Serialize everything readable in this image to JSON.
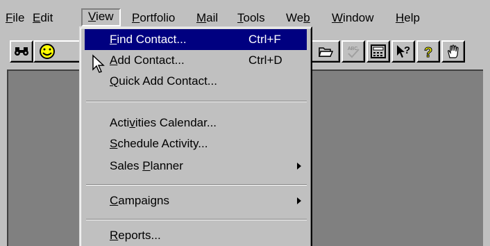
{
  "menubar": {
    "items": [
      {
        "pre": "",
        "acc": "F",
        "post": "ile"
      },
      {
        "pre": "",
        "acc": "E",
        "post": "dit"
      },
      {
        "pre": "",
        "acc": "V",
        "post": "iew"
      },
      {
        "pre": "",
        "acc": "P",
        "post": "ortfolio"
      },
      {
        "pre": "",
        "acc": "M",
        "post": "ail"
      },
      {
        "pre": "",
        "acc": "T",
        "post": "ools"
      },
      {
        "pre": "We",
        "acc": "b",
        "post": ""
      },
      {
        "pre": "",
        "acc": "W",
        "post": "indow"
      },
      {
        "pre": "",
        "acc": "H",
        "post": "elp"
      }
    ]
  },
  "toolbar": {
    "buttons": [
      {
        "icon": "binoculars-icon"
      },
      {
        "icon": "smiley-icon"
      },
      {
        "icon": "open-folder-icon"
      },
      {
        "icon": "spell-check-icon"
      },
      {
        "icon": "calculator-icon"
      },
      {
        "icon": "whats-this-icon"
      },
      {
        "icon": "help-icon"
      },
      {
        "icon": "hand-icon"
      }
    ]
  },
  "view_menu": {
    "items": [
      {
        "pre": "",
        "acc": "F",
        "post": "ind Contact...",
        "shortcut": "Ctrl+F",
        "highlighted": true
      },
      {
        "pre": "",
        "acc": "A",
        "post": "dd Contact...",
        "shortcut": "Ctrl+D"
      },
      {
        "pre": "",
        "acc": "Q",
        "post": "uick Add Contact...",
        "shortcut": ""
      },
      {
        "pre": "Acti",
        "acc": "v",
        "post": "ities Calendar...",
        "shortcut": ""
      },
      {
        "pre": "",
        "acc": "S",
        "post": "chedule Activity...",
        "shortcut": ""
      },
      {
        "pre": "Sales ",
        "acc": "P",
        "post": "lanner",
        "shortcut": "",
        "submenu": true
      },
      {
        "pre": "",
        "acc": "C",
        "post": "ampaigns",
        "shortcut": "",
        "submenu": true
      },
      {
        "pre": "",
        "acc": "R",
        "post": "eports...",
        "shortcut": ""
      }
    ]
  },
  "colors": {
    "highlight": "#000080",
    "face": "#c0c0c0",
    "workspace": "#808080"
  }
}
